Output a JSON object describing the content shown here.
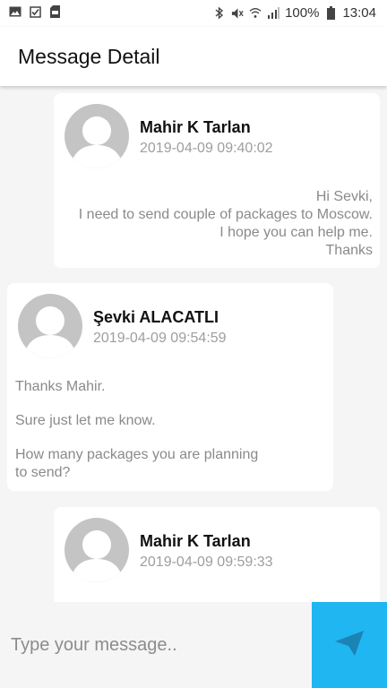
{
  "status_bar": {
    "battery": "100%",
    "time": "13:04",
    "left_icons": [
      "image-icon",
      "checkbox-icon",
      "sd-card-icon"
    ],
    "right_icons": [
      "bluetooth-icon",
      "mute-icon",
      "wifi-icon",
      "signal-icon",
      "battery-icon"
    ]
  },
  "header": {
    "title": "Message Detail"
  },
  "messages": [
    {
      "sender": "Mahir K Tarlan",
      "timestamp": "2019-04-09 09:40:02",
      "alignment": "right",
      "lines": [
        "Hi Sevki,",
        "I need to send couple of packages to Moscow.",
        "I hope you can help me.",
        "Thanks"
      ]
    },
    {
      "sender": "Şevki ALACATLI",
      "timestamp": "2019-04-09 09:54:59",
      "alignment": "left",
      "lines": [
        "Thanks Mahir.",
        "",
        "Sure just let me know.",
        "",
        "How many packages you are planning",
        "to send?"
      ]
    },
    {
      "sender": "Mahir K Tarlan",
      "timestamp": "2019-04-09 09:59:33",
      "alignment": "right",
      "lines": []
    }
  ],
  "composer": {
    "placeholder": "Type your message..",
    "value": ""
  },
  "colors": {
    "accent": "#1fb6f2",
    "avatar": "#c4c4c4",
    "card": "#ffffff",
    "background": "#f5f5f5"
  }
}
